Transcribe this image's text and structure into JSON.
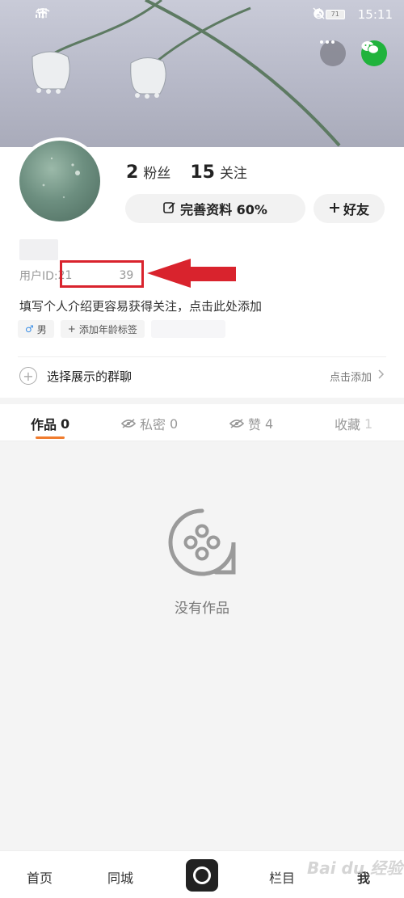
{
  "status_bar": {
    "network": "4G",
    "battery": "71",
    "time": "15:11"
  },
  "stats": {
    "fans_count": "2",
    "fans_label": "粉丝",
    "following_count": "15",
    "following_label": "关注"
  },
  "buttons": {
    "edit_profile": "完善资料 60%",
    "friends": "好友"
  },
  "profile": {
    "uid_prefix": "用户ID:",
    "uid_start": "21",
    "uid_end": "39",
    "intro": "填写个人介绍更容易获得关注，点击此处添加",
    "gender_tag": "男",
    "age_tag": "添加年龄标签"
  },
  "group_chat": {
    "label": "选择展示的群聊",
    "action": "点击添加"
  },
  "tabs": [
    {
      "label": "作品",
      "count": "0"
    },
    {
      "label": "私密",
      "count": "0"
    },
    {
      "label": "赞",
      "count": "4"
    },
    {
      "label": "收藏",
      "count": "1"
    }
  ],
  "empty_state": {
    "text": "没有作品"
  },
  "bottom_nav": {
    "home": "首页",
    "local": "同城",
    "channel": "栏目",
    "me": "我"
  },
  "watermark": "Bai du 经验",
  "colors": {
    "accent": "#f07c2e",
    "annotation_red": "#d9232d",
    "wechat_green": "#20b33c"
  }
}
